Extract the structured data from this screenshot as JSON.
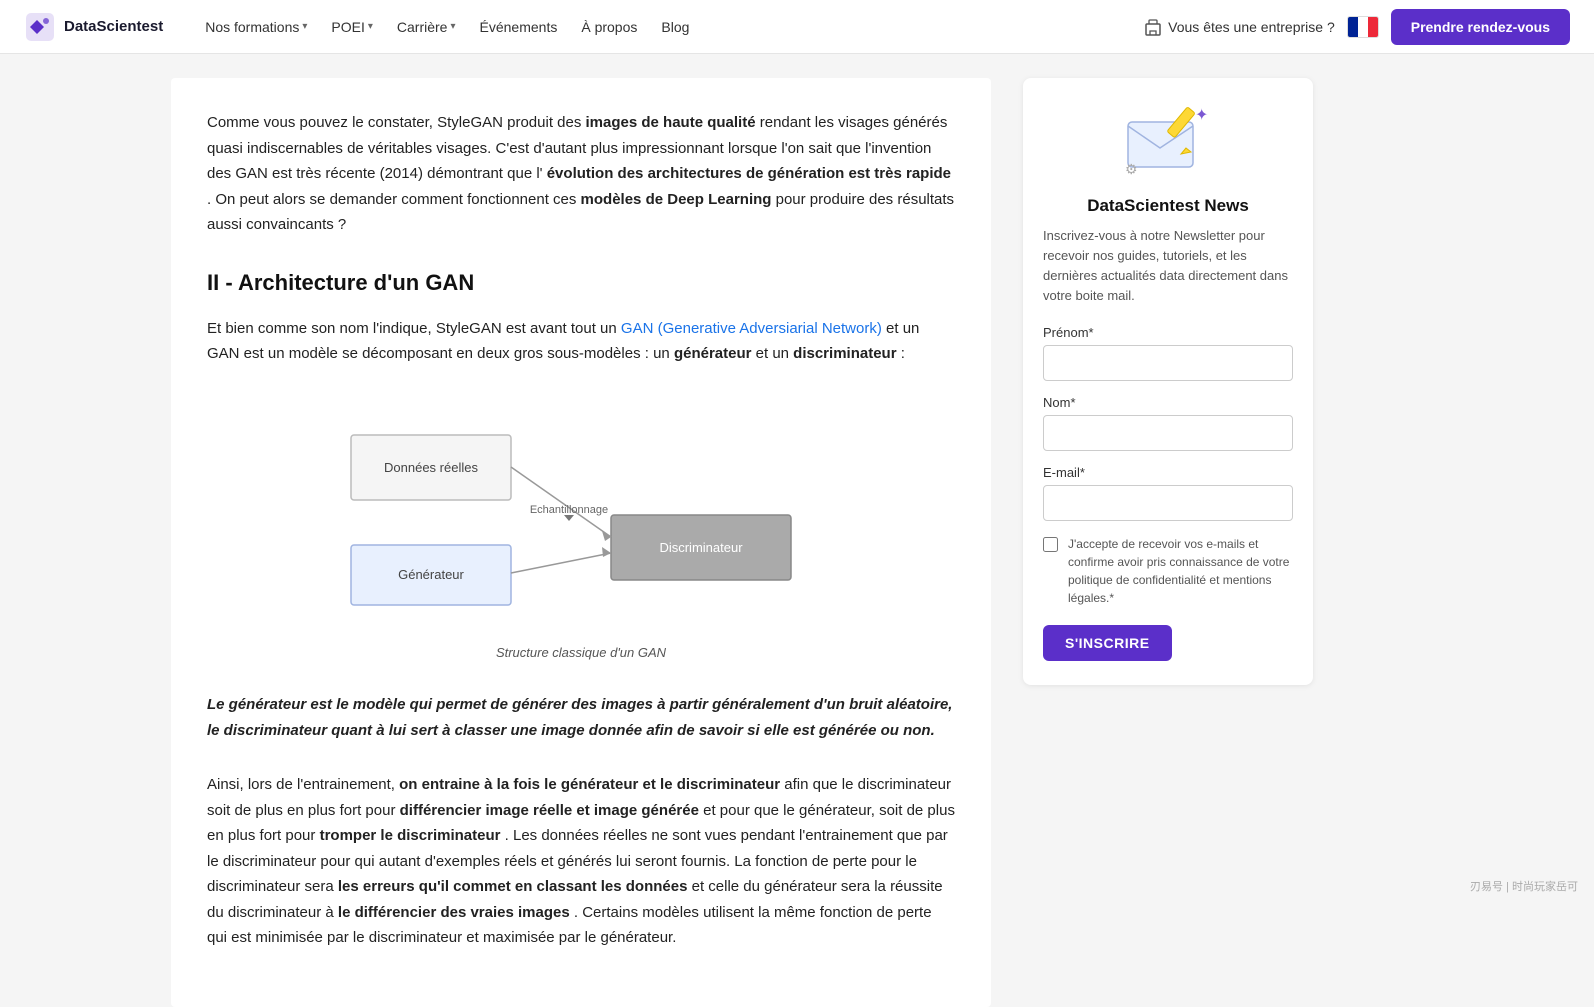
{
  "navbar": {
    "logo_text": "DataScientest",
    "nav_items": [
      {
        "label": "Nos formations",
        "has_dropdown": true
      },
      {
        "label": "POEI",
        "has_dropdown": true
      },
      {
        "label": "Carrière",
        "has_dropdown": true
      },
      {
        "label": "Événements",
        "has_dropdown": false
      },
      {
        "label": "À propos",
        "has_dropdown": false
      },
      {
        "label": "Blog",
        "has_dropdown": false
      }
    ],
    "entreprise_label": "Vous êtes une entreprise ?",
    "cta_label": "Prendre rendez-vous"
  },
  "article": {
    "intro_text_1": "Comme vous pouvez le constater, StyleGAN produit des ",
    "intro_bold_1": "images de haute qualité",
    "intro_text_2": " rendant les visages générés quasi indiscernables de véritables visages. C'est d'autant plus impressionnant lorsque l'on sait que l'invention des GAN est très récente (2014) démontrant que l'",
    "intro_bold_2": "évolution des architectures de génération est très rapide",
    "intro_text_3": ". On peut alors se demander comment fonctionnent ces ",
    "intro_bold_3": "modèles de Deep Learning",
    "intro_text_4": " pour produire des résultats aussi convaincants ?",
    "section2_title": "II - Architecture d'un GAN",
    "section2_intro_1": "Et bien comme son nom l'indique, StyleGAN est avant tout un ",
    "section2_link_text": "GAN (Generative Adversiarial Network)",
    "section2_intro_2": " et un GAN est un modèle se décomposant en deux gros sous-modèles : un ",
    "section2_bold_1": "générateur",
    "section2_intro_3": " et un ",
    "section2_bold_2": "discriminateur",
    "section2_intro_4": " :",
    "diagram_label1": "Données réelles",
    "diagram_label2": "Echantillonnage",
    "diagram_label3": "Discriminateur",
    "diagram_label4": "Générateur",
    "diagram_caption": "Structure classique d'un GAN",
    "blockquote": "Le générateur est le modèle qui permet de générer des images à partir généralement d'un bruit aléatoire, le discriminateur quant à lui sert à classer une image donnée afin de savoir si elle est générée ou non.",
    "training_text_1": "Ainsi, lors de l'entrainement, ",
    "training_bold_1": "on entraine à la fois le générateur et le discriminateur",
    "training_text_2": " afin que le discriminateur soit de plus en plus fort pour ",
    "training_bold_2": "différencier image réelle et image générée",
    "training_text_3": " et pour que le générateur, soit de plus en plus fort pour ",
    "training_bold_3": "tromper le discriminateur",
    "training_text_4": ". Les données réelles ne sont vues pendant l'entrainement que par le discriminateur pour qui autant d'exemples réels et générés lui seront fournis. La fonction de perte pour le discriminateur sera ",
    "training_bold_4": "les erreurs qu'il commet en classant les données",
    "training_text_5": " et celle du générateur sera la réussite du discriminateur à ",
    "training_bold_5": "le différencier des vraies images",
    "training_text_6": ". Certains modèles utilisent la même fonction de perte qui est minimisée par le discriminateur et maximisée par le générateur."
  },
  "newsletter": {
    "title": "DataScientest News",
    "description": "Inscrivez-vous à notre Newsletter pour recevoir nos guides, tutoriels, et les dernières actualités data directement dans votre boite mail.",
    "prenom_label": "Prénom*",
    "prenom_placeholder": "",
    "nom_label": "Nom*",
    "nom_placeholder": "",
    "email_label": "E-mail*",
    "email_placeholder": "",
    "consent_text": "J'accepte de recevoir vos e-mails et confirme avoir pris connaissance de votre politique de confidentialité et mentions légales.*",
    "submit_label": "S'INSCRIRE"
  },
  "watermark": "刃易号 | 时尚玩家岳可"
}
